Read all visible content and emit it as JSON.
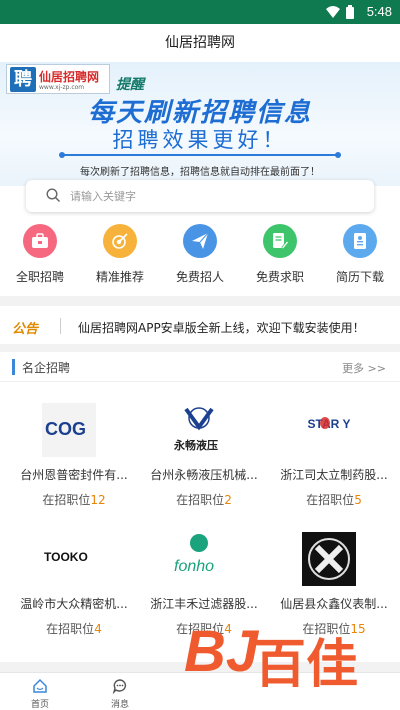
{
  "status": {
    "time": "5:48"
  },
  "title": "仙居招聘网",
  "banner": {
    "logo_char": "聘",
    "logo_name": "仙居招聘网",
    "logo_url": "www.xj-zp.com",
    "remind": "提醒",
    "headline": "每天刷新招聘信息",
    "subhead": "招聘效果更好！",
    "caption": "每次刷新了招聘信息，招聘信息就自动排在最前面了！"
  },
  "search": {
    "placeholder": "请输入关键字"
  },
  "categories": [
    {
      "label": "全职招聘",
      "icon": "briefcase-icon",
      "color": "#f5687f"
    },
    {
      "label": "精准推荐",
      "icon": "target-icon",
      "color": "#f6b23a"
    },
    {
      "label": "免费招人",
      "icon": "paper-plane-icon",
      "color": "#4a94e6"
    },
    {
      "label": "免费求职",
      "icon": "document-edit-icon",
      "color": "#3ec56b"
    },
    {
      "label": "简历下载",
      "icon": "resume-icon",
      "color": "#5ca9ee"
    }
  ],
  "notice": {
    "tag": "公告",
    "message": "仙居招聘网APP安卓版全新上线，欢迎下载安装使用！"
  },
  "section": {
    "title": "名企招聘",
    "more": "更多 >>"
  },
  "companies": [
    {
      "name": "台州恩普密封件有...",
      "positions_label": "在招职位",
      "positions": "12",
      "logo_text": "COG"
    },
    {
      "name": "台州永畅液压机械...",
      "positions_label": "在招职位",
      "positions": "2",
      "logo_text": "永畅液压"
    },
    {
      "name": "浙江司太立制药股...",
      "positions_label": "在招职位",
      "positions": "5",
      "logo_text": "STAR Y"
    },
    {
      "name": "温岭市大众精密机...",
      "positions_label": "在招职位",
      "positions": "4",
      "logo_text": "TOOKO"
    },
    {
      "name": "浙江丰禾过滤器股...",
      "positions_label": "在招职位",
      "positions": "4",
      "logo_text": "fonho"
    },
    {
      "name": "仙居县众鑫仪表制...",
      "positions_label": "在招职位",
      "positions": "15",
      "logo_text": ""
    }
  ],
  "tabs": [
    {
      "label": "首页",
      "icon": "home-icon",
      "active": true
    },
    {
      "label": "消息",
      "icon": "message-icon",
      "active": false
    }
  ],
  "watermark": {
    "mark": "BJ",
    "text": "百佳"
  },
  "colors": {
    "status_bar": "#0f7a4f",
    "accent": "#3a86d8",
    "count": "#e8850a",
    "watermark": "#ef5b2e"
  }
}
